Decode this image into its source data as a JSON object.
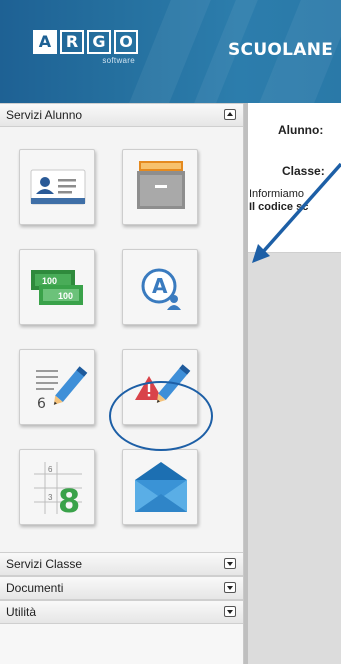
{
  "header": {
    "logo_letters": [
      "A",
      "R",
      "G",
      "O"
    ],
    "logo_subtitle": "software",
    "app_name": "SCUOLANE"
  },
  "sidebar": {
    "sections": [
      {
        "label": "Servizi Alunno",
        "state": "expanded"
      },
      {
        "label": "Servizi Classe",
        "state": "collapsed"
      },
      {
        "label": "Documenti",
        "state": "collapsed"
      },
      {
        "label": "Utilità",
        "state": "collapsed"
      }
    ],
    "tiles": [
      {
        "icon": "student-id-card-icon"
      },
      {
        "icon": "archive-drawer-icon"
      },
      {
        "icon": "banknotes-icon",
        "amount_1": "100",
        "amount_2": "100"
      },
      {
        "icon": "absences-user-icon",
        "letter": "A",
        "highlighted": true
      },
      {
        "icon": "grades-pencil-icon",
        "digit": "6"
      },
      {
        "icon": "notes-alert-pencil-icon"
      },
      {
        "icon": "grade-grid-icon",
        "small_digits": [
          "6",
          "3"
        ],
        "big_digit": "8"
      },
      {
        "icon": "envelope-icon"
      }
    ]
  },
  "main": {
    "student_label": "Alunno:",
    "class_label": "Classe:",
    "info_text": "Informiamo",
    "code_text": "Il codice sc"
  },
  "colors": {
    "header": "#25709f",
    "accent_blue": "#1d5fa6",
    "green": "#3aa24a",
    "alert_red": "#d9434a"
  }
}
